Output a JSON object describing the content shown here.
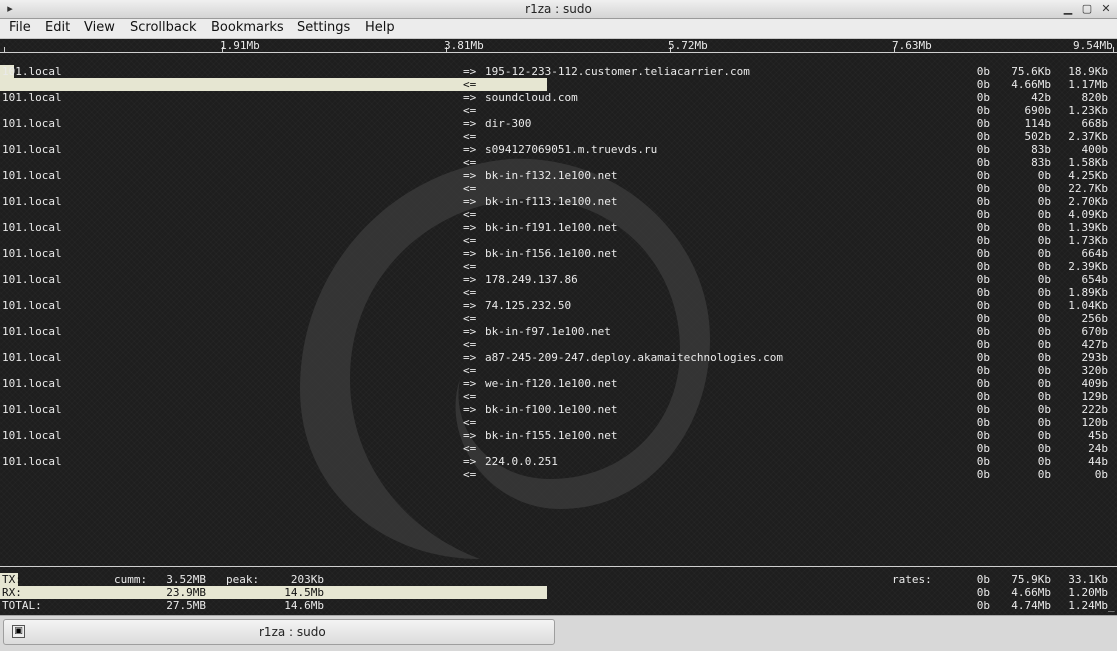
{
  "window": {
    "title": "r1za : sudo",
    "menu_icon": "▸",
    "minimize": "▁",
    "maximize": "▢",
    "close": "✕"
  },
  "menu": [
    "File",
    "Edit",
    "View",
    "Scrollback",
    "Bookmarks",
    "Settings",
    "Help"
  ],
  "scale": [
    "1.91Mb",
    "3.81Mb",
    "5.72Mb",
    "7.63Mb",
    "9.54Mb"
  ],
  "flows": [
    {
      "src": "101.local",
      "dst": "195-12-233-112.customer.teliacarrier.com",
      "out": [
        "0b",
        "75.6Kb",
        "18.9Kb"
      ],
      "in": [
        "0b",
        "4.66Mb",
        "1.17Mb"
      ]
    },
    {
      "src": "101.local",
      "dst": "soundcloud.com",
      "out": [
        "0b",
        "42b",
        "820b"
      ],
      "in": [
        "0b",
        "690b",
        "1.23Kb"
      ]
    },
    {
      "src": "101.local",
      "dst": "dir-300",
      "out": [
        "0b",
        "114b",
        "668b"
      ],
      "in": [
        "0b",
        "502b",
        "2.37Kb"
      ]
    },
    {
      "src": "101.local",
      "dst": "s094127069051.m.truevds.ru",
      "out": [
        "0b",
        "83b",
        "400b"
      ],
      "in": [
        "0b",
        "83b",
        "1.58Kb"
      ]
    },
    {
      "src": "101.local",
      "dst": "bk-in-f132.1e100.net",
      "out": [
        "0b",
        "0b",
        "4.25Kb"
      ],
      "in": [
        "0b",
        "0b",
        "22.7Kb"
      ]
    },
    {
      "src": "101.local",
      "dst": "bk-in-f113.1e100.net",
      "out": [
        "0b",
        "0b",
        "2.70Kb"
      ],
      "in": [
        "0b",
        "0b",
        "4.09Kb"
      ]
    },
    {
      "src": "101.local",
      "dst": "bk-in-f191.1e100.net",
      "out": [
        "0b",
        "0b",
        "1.39Kb"
      ],
      "in": [
        "0b",
        "0b",
        "1.73Kb"
      ]
    },
    {
      "src": "101.local",
      "dst": "bk-in-f156.1e100.net",
      "out": [
        "0b",
        "0b",
        "664b"
      ],
      "in": [
        "0b",
        "0b",
        "2.39Kb"
      ]
    },
    {
      "src": "101.local",
      "dst": "178.249.137.86",
      "out": [
        "0b",
        "0b",
        "654b"
      ],
      "in": [
        "0b",
        "0b",
        "1.89Kb"
      ]
    },
    {
      "src": "101.local",
      "dst": "74.125.232.50",
      "out": [
        "0b",
        "0b",
        "1.04Kb"
      ],
      "in": [
        "0b",
        "0b",
        "256b"
      ]
    },
    {
      "src": "101.local",
      "dst": "bk-in-f97.1e100.net",
      "out": [
        "0b",
        "0b",
        "670b"
      ],
      "in": [
        "0b",
        "0b",
        "427b"
      ]
    },
    {
      "src": "101.local",
      "dst": "a87-245-209-247.deploy.akamaitechnologies.com",
      "out": [
        "0b",
        "0b",
        "293b"
      ],
      "in": [
        "0b",
        "0b",
        "320b"
      ]
    },
    {
      "src": "101.local",
      "dst": "we-in-f120.1e100.net",
      "out": [
        "0b",
        "0b",
        "409b"
      ],
      "in": [
        "0b",
        "0b",
        "129b"
      ]
    },
    {
      "src": "101.local",
      "dst": "bk-in-f100.1e100.net",
      "out": [
        "0b",
        "0b",
        "222b"
      ],
      "in": [
        "0b",
        "0b",
        "120b"
      ]
    },
    {
      "src": "101.local",
      "dst": "bk-in-f155.1e100.net",
      "out": [
        "0b",
        "0b",
        "45b"
      ],
      "in": [
        "0b",
        "0b",
        "24b"
      ]
    },
    {
      "src": "101.local",
      "dst": "224.0.0.251",
      "out": [
        "0b",
        "0b",
        "44b"
      ],
      "in": [
        "0b",
        "0b",
        "0b"
      ]
    }
  ],
  "arrow_out": "=>",
  "arrow_in": "<=",
  "totals": {
    "cumm_label": "cumm:",
    "peak_label": "peak:",
    "rates_label": "rates:",
    "rows": [
      {
        "label": "TX:",
        "cumm": "3.52MB",
        "peak": "203Kb",
        "rates": [
          "0b",
          "75.9Kb",
          "33.1Kb"
        ]
      },
      {
        "label": "RX:",
        "cumm": "23.9MB",
        "peak": "14.5Mb",
        "rates": [
          "0b",
          "4.66Mb",
          "1.20Mb"
        ]
      },
      {
        "label": "TOTAL:",
        "cumm": "27.5MB",
        "peak": "14.6Mb",
        "rates": [
          "0b",
          "4.74Mb",
          "1.24Mb"
        ]
      }
    ]
  },
  "bars": {
    "flow0_in_fraction": 0.49,
    "rx_fraction": 0.49
  },
  "cursor": "_",
  "taskbar": {
    "label": "r1za : sudo",
    "icon": "▣"
  }
}
